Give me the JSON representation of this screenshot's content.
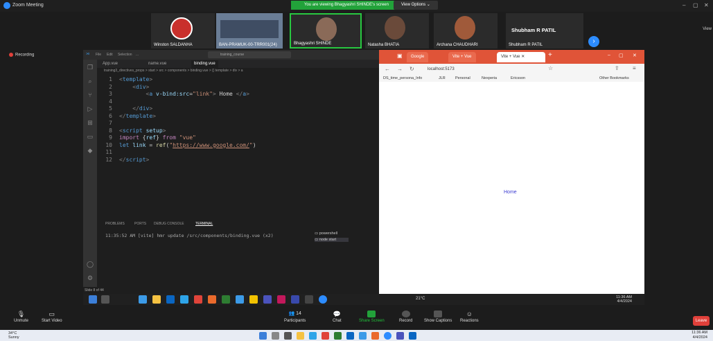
{
  "zoom": {
    "window_title": "Zoom Meeting",
    "viewing_banner": "You are viewing Bhagyashri SHINDE's screen",
    "view_options": "View Options",
    "view_tab": "View",
    "recording": "Recording",
    "participants": [
      {
        "name": "Winston SALDANHA"
      },
      {
        "name": "BAN-PRAMUK-00-TRR001(24)"
      },
      {
        "name": "Bhagyashri SHINDE"
      },
      {
        "name": "Natasha BHATIA"
      },
      {
        "name": "Archana CHAUDHARI"
      },
      {
        "name": "Shubham R PATIL",
        "tile_label": "Shubham R PATIL"
      }
    ],
    "controls": {
      "unmute": "Unmute",
      "start_video": "Start Video",
      "participants": "Participants",
      "participants_count": "14",
      "chat": "Chat",
      "share_screen": "Share Screen",
      "record": "Record",
      "show_captions": "Show Captions",
      "reactions": "Reactions",
      "leave": "Leave"
    }
  },
  "vscode": {
    "menu": [
      "File",
      "Edit",
      "Selection",
      "..."
    ],
    "search": "training_course",
    "tabs": [
      "App.vue",
      "name.vue",
      "binding.vue"
    ],
    "breadcrumb": "training3_directives_props > start > src > components > binding.vue > {} template > div > a",
    "code_lines": [
      {
        "n": "1",
        "html": "<span class='bracket'>&lt;</span><span class='blue'>template</span><span class='bracket'>&gt;</span>"
      },
      {
        "n": "2",
        "html": "    <span class='bracket'>&lt;</span><span class='blue'>div</span><span class='bracket'>&gt;</span>"
      },
      {
        "n": "3",
        "html": "        <span class='bracket'>&lt;</span><span class='blue'>a</span> <span class='attr'>v-bind:src</span><span class='plain'>=</span><span class='str'>\"link\"</span><span class='bracket'>&gt;</span><span class='plain'> Home </span><span class='bracket'>&lt;/</span><span class='blue'>a</span><span class='bracket'>&gt;</span>"
      },
      {
        "n": "4",
        "html": ""
      },
      {
        "n": "5",
        "html": "    <span class='bracket'>&lt;/</span><span class='blue'>div</span><span class='bracket'>&gt;</span>"
      },
      {
        "n": "6",
        "html": "<span class='bracket'>&lt;/</span><span class='blue'>template</span><span class='bracket'>&gt;</span>"
      },
      {
        "n": "7",
        "html": ""
      },
      {
        "n": "8",
        "html": "<span class='bracket'>&lt;</span><span class='blue'>script</span> <span class='attr'>setup</span><span class='bracket'>&gt;</span>"
      },
      {
        "n": "9",
        "html": "<span class='kw'>import</span> <span class='plain'>{</span><span class='attr'>ref</span><span class='plain'>}</span> <span class='kw'>from</span> <span class='str'>\"vue\"</span>"
      },
      {
        "n": "10",
        "html": "<span class='blue'>let</span> <span class='attr'>link</span> <span class='plain'>=</span> <span class='fn'>ref</span><span class='plain'>(</span><span class='str'>\"<u>https://www.google.com/</u>\"</span><span class='plain'>)</span>"
      },
      {
        "n": "11",
        "html": ""
      },
      {
        "n": "12",
        "html": "<span class='bracket'>&lt;/</span><span class='blue'>script</span><span class='bracket'>&gt;</span>"
      }
    ],
    "panel_tabs": [
      "PROBLEMS",
      "PORTS",
      "DEBUG CONSOLE",
      "TERMINAL"
    ],
    "terminal_line": "11:35:52 AM [vite] hmr update /src/components/binding.vue (x2)",
    "terminals": [
      "powershell",
      "node start"
    ],
    "status": "Slide 8 of 44"
  },
  "browser": {
    "tabs": [
      "Google",
      "Vite + Vue",
      "Vite + Vue"
    ],
    "address": "localhost:5173",
    "bookmarks": [
      "DS_time_persona_Info",
      "JLR",
      "Personal",
      "Nexperia",
      "Ericsson",
      "Other Bookmarks"
    ],
    "page_link": "Home"
  },
  "inner_taskbar": {
    "weather": "21°C",
    "time": "11:36 AM",
    "date": "4/4/2024"
  },
  "windows": {
    "weather_temp": "34°C",
    "weather_desc": "Sunny",
    "time": "11:36 AM",
    "date": "4/4/2024"
  }
}
